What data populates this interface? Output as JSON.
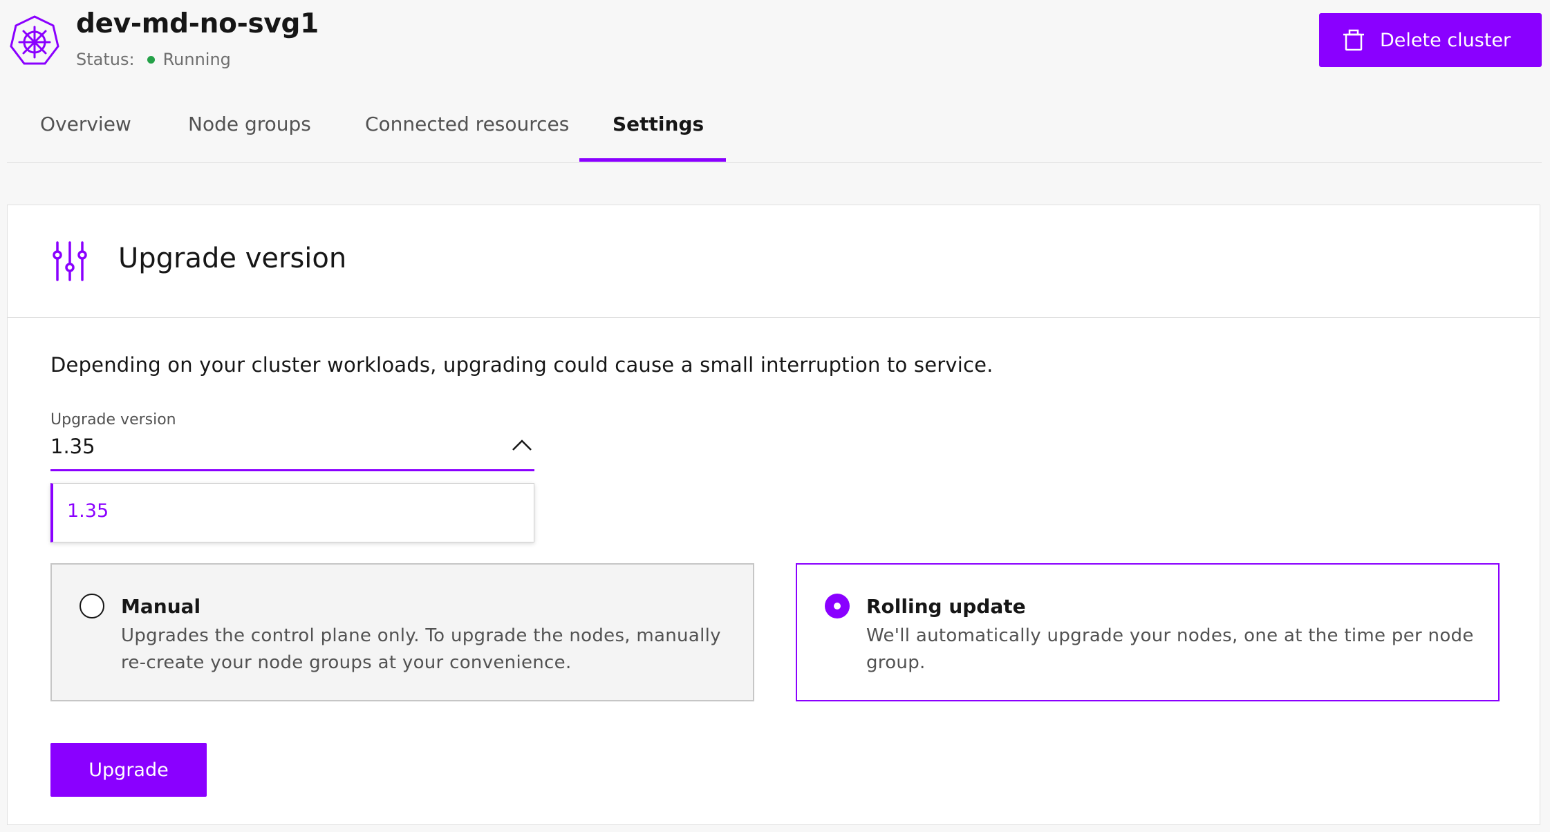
{
  "header": {
    "cluster_name": "dev-md-no-svg1",
    "status_label": "Status:",
    "status_value": "Running",
    "status_color": "#24a148",
    "logo_icon": "kubernetes-helm-icon",
    "delete_button": {
      "label": "Delete cluster",
      "icon": "trash-icon"
    }
  },
  "tabs": [
    {
      "label": "Overview",
      "active": false
    },
    {
      "label": "Node groups",
      "active": false
    },
    {
      "label": "Connected resources",
      "active": false
    },
    {
      "label": "Settings",
      "active": true
    }
  ],
  "card": {
    "icon": "sliders-icon",
    "title": "Upgrade version",
    "description": "Depending on your cluster workloads, upgrading could cause a small interruption to service.",
    "select": {
      "label": "Upgrade version",
      "value": "1.35",
      "expanded": true,
      "options": [
        "1.35"
      ]
    },
    "strategies": [
      {
        "title": "Manual",
        "description": "Upgrades the control plane only. To upgrade the nodes, manually re-create your node groups at your convenience.",
        "selected": false
      },
      {
        "title": "Rolling update",
        "description": "We'll automatically upgrade your nodes, one at the time per node group.",
        "selected": true
      }
    ],
    "submit_label": "Upgrade"
  },
  "colors": {
    "accent": "#8a00ff",
    "background": "#f7f7f7",
    "text": "#161616",
    "muted_text": "#525252"
  }
}
